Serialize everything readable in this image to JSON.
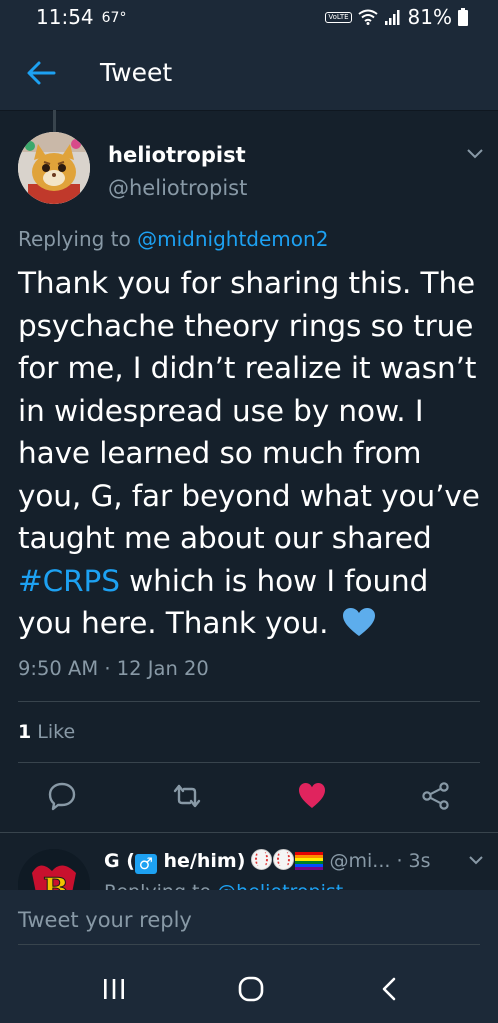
{
  "status_bar": {
    "time": "11:54",
    "temperature": "67°",
    "volte": "VoLTE",
    "battery": "81%"
  },
  "app_bar": {
    "title": "Tweet",
    "back_icon": "arrow-left-icon"
  },
  "tweet": {
    "author_name": "heliotropist",
    "author_handle": "@heliotropist",
    "replying_prefix": "Replying to ",
    "replying_to": "@midnightdemon2",
    "text_part1": "Thank you for sharing this. The psychache theory rings so true for me, I didn’t realize it wasn’t in widespread use by now. I have learned so much from you, G, far beyond what you’ve taught me about our shared ",
    "hashtag": "#CRPS",
    "text_part2": " which is how I found you here. Thank you.",
    "emoji": "blue-heart-icon",
    "timestamp": "9:50 AM · 12 Jan 20",
    "likes_count": "1",
    "likes_label": " Like"
  },
  "actions": {
    "reply": "reply-icon",
    "retweet": "retweet-icon",
    "like": "heart-icon",
    "share": "share-icon",
    "like_color": "#e0245e"
  },
  "reply_tweet": {
    "name_start": "G (",
    "name_end": " he/him)",
    "handle": "@mi...",
    "time": "· 3s",
    "sub_prefix": "Replying to ",
    "sub_link": "@heliotropist"
  },
  "compose": {
    "placeholder": "Tweet your reply"
  },
  "navbar": {
    "recents": "recents-icon",
    "home": "home-icon",
    "back": "back-icon"
  },
  "colors": {
    "background": "#15202b",
    "bar": "#1c2938",
    "accent": "#1da1f2",
    "secondary_text": "#8899a6"
  }
}
